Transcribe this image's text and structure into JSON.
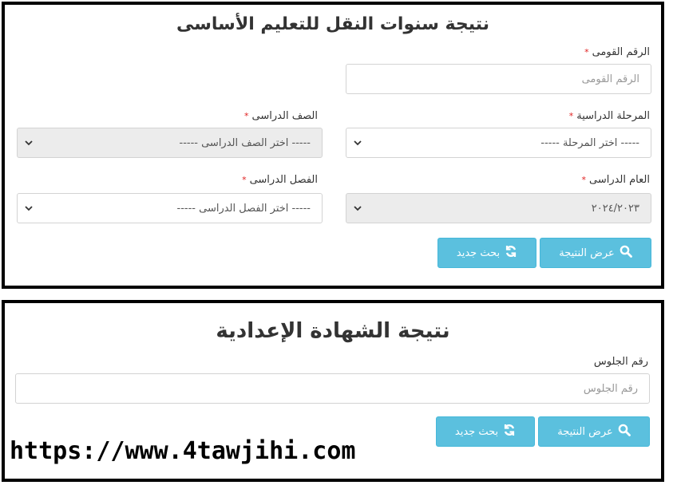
{
  "panel1": {
    "title": "نتيجة سنوات النقل للتعليم الأساسى",
    "national_id": {
      "label": "الرقم القومى",
      "required_mark": "*",
      "placeholder": "الرقم القومى"
    },
    "stage": {
      "label": "المرحلة الدراسية",
      "required_mark": "*",
      "value": "----- اختر المرحلة -----"
    },
    "grade": {
      "label": "الصف الدراسى",
      "required_mark": "*",
      "value": "----- اختر الصف الدراسى -----"
    },
    "year": {
      "label": "العام الدراسى",
      "required_mark": "*",
      "value": "٢٠٢٤/٢٠٢٣"
    },
    "class": {
      "label": "الفصل الدراسى",
      "required_mark": "*",
      "value": "----- اختر الفصل الدراسى -----"
    },
    "show_result_label": "عرض النتيجة",
    "new_search_label": "بحث جديد"
  },
  "panel2": {
    "title": "نتيجة الشهادة الإعدادية",
    "seat_number": {
      "label": "رقم الجلوس",
      "placeholder": "رقم الجلوس"
    },
    "show_result_label": "عرض النتيجة",
    "new_search_label": "بحث جديد"
  },
  "footer": {
    "url": "https://www.4tawjihi.com"
  },
  "colors": {
    "button": "#5bc0de",
    "required": "#e02020",
    "disabled_bg": "#ececec"
  }
}
